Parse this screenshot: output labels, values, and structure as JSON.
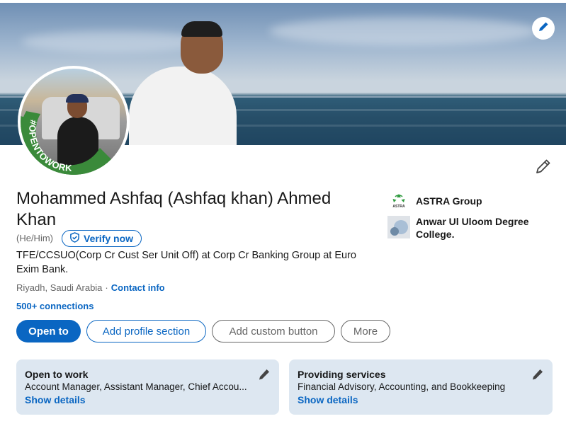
{
  "profile": {
    "name": "Mohammed Ashfaq (Ashfaq khan) Ahmed Khan",
    "pronouns": "(He/Him)",
    "verify_label": "Verify now",
    "headline": "TFE/CCSUO(Corp Cr Cust Ser Unit Off) at Corp Cr Banking Group at Euro Exim Bank.",
    "location": "Riyadh, Saudi Arabia",
    "location_sep": "·",
    "contact_info": "Contact info",
    "connections": "500+ connections",
    "open_to_work_badge": "#OPENTOWORK"
  },
  "actions": {
    "open_to": "Open to",
    "add_profile_section": "Add profile section",
    "add_custom_button": "Add custom button",
    "more": "More"
  },
  "experience": {
    "company": "ASTRA Group",
    "company_logo_text": "ASTRA",
    "education": "Anwar Ul Uloom Degree College."
  },
  "cards": {
    "open_to_work": {
      "title": "Open to work",
      "body": "Account Manager, Assistant Manager, Chief Accou...",
      "link": "Show details"
    },
    "providing_services": {
      "title": "Providing services",
      "body": "Financial Advisory, Accounting, and Bookkeeping",
      "link": "Show details"
    }
  },
  "icons": {
    "banner_edit": "pencil-icon",
    "profile_edit": "pencil-icon",
    "verify": "shield-check-icon"
  },
  "colors": {
    "brand_blue": "#0a66c2",
    "card_bg": "#dde7f1",
    "open_to_work_green": "#3a8a3a"
  }
}
